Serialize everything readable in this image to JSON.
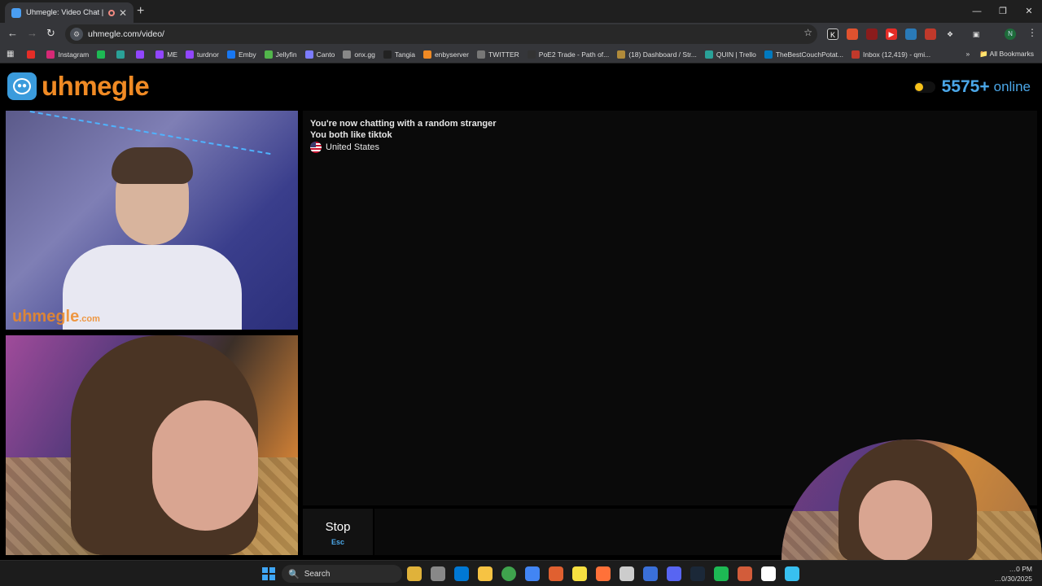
{
  "browser": {
    "tab_title": "Uhmegle: Video Chat | Ran",
    "tab_close": "✕",
    "new_tab": "+",
    "url": "uhmegle.com/video/",
    "bookmarks": [
      {
        "label": "",
        "color": "#e52d27"
      },
      {
        "label": "Instagram",
        "color": "#d62976"
      },
      {
        "label": "",
        "color": "#1db954"
      },
      {
        "label": "",
        "color": "#2aa198"
      },
      {
        "label": "",
        "color": "#9146ff"
      },
      {
        "label": "ME",
        "color": "#9146ff"
      },
      {
        "label": "turdnor",
        "color": "#9146ff"
      },
      {
        "label": "Emby",
        "color": "#1877f2"
      },
      {
        "label": "Jellyfin",
        "color": "#52b54b"
      },
      {
        "label": "Canto",
        "color": "#7c7cff"
      },
      {
        "label": "onx.gg",
        "color": "#888888"
      },
      {
        "label": "Tangia",
        "color": "#222222"
      },
      {
        "label": "enbyserver",
        "color": "#f08a24"
      },
      {
        "label": "TWITTER",
        "color": "#777777"
      },
      {
        "label": "PoE2 Trade - Path of...",
        "color": "#333333"
      },
      {
        "label": "(18) Dashboard / Str...",
        "color": "#b08a3a"
      },
      {
        "label": "QUIN | Trello",
        "color": "#2aa198"
      },
      {
        "label": "TheBestCouchPotat...",
        "color": "#0079bf"
      },
      {
        "label": "Inbox (12,419) - qmi...",
        "color": "#c0392b"
      }
    ],
    "all_bookmarks": "All Bookmarks",
    "more_bookmarks": "»",
    "profile_initial": "N"
  },
  "site": {
    "logo_text": "uhmegle",
    "online_count": "5575+",
    "online_label": "online",
    "watermark_main": "uhmegle",
    "watermark_suffix": ".com"
  },
  "chat": {
    "status_line": "You're now chatting with a random stranger",
    "interest_line": "You both like tiktok",
    "country": "United States",
    "message_value": "",
    "stop_label": "Stop",
    "stop_shortcut": "Esc"
  },
  "taskbar": {
    "search_label": "Search",
    "time": "…0 PM",
    "date": "…0/30/2025",
    "icon_colors": [
      "#e0b23a",
      "#888888",
      "#0078d4",
      "#f6c343",
      "#3fa34d",
      "#4285f4",
      "#e06030",
      "#f7e041",
      "#ff7139",
      "#cccccc",
      "#3a6fd8",
      "#5865f2",
      "#1b2838",
      "#1db954",
      "#d25c3a",
      "#ffffff",
      "#38c0f0"
    ]
  },
  "colors": {
    "brand_orange": "#f08a24",
    "accent_blue": "#4ba7e8",
    "online_dot": "#f7c21a"
  }
}
